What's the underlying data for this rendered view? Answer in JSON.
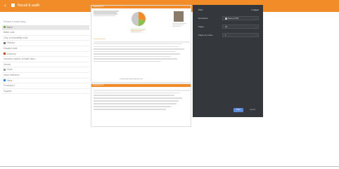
{
  "topbar": {
    "back_glyph": "‹",
    "title": "Recall & audit"
  },
  "left_list": [
    {
      "label": "Perform a recall using...",
      "type": "hdr"
    },
    {
      "label": "Batch",
      "type": "sel",
      "icon_color": "#7cb342"
    },
    {
      "label": "Batch code",
      "type": "row"
    },
    {
      "label": "Crop or traceability code",
      "type": "row"
    },
    {
      "label": "Delivery",
      "type": "row",
      "icon_color": "#607d8b"
    },
    {
      "label": "Dispatch date",
      "type": "row"
    },
    {
      "label": "Inventory",
      "type": "row",
      "icon_color": "#d84315"
    },
    {
      "label": "Inventory number of batch input",
      "type": "row"
    },
    {
      "label": "Invoice",
      "type": "row"
    },
    {
      "label": "Order",
      "type": "row",
      "icon_color": "#90a4ae"
    },
    {
      "label": "Order reference",
      "type": "row"
    },
    {
      "label": "Sales",
      "type": "row",
      "icon_color": "#1e88e5"
    },
    {
      "label": "Purchase #",
      "type": "row"
    },
    {
      "label": "Supplier",
      "type": "row"
    }
  ],
  "paper1": {
    "header": "Recall batch #",
    "section": "Inventory movements",
    "footer": "Document generated with agriculture tool"
  },
  "paper2": {
    "header": "Recall batch #"
  },
  "dialog": {
    "title": "Print",
    "pages_count": "2 pages",
    "destination_label": "Destination",
    "destination_value": "Save as PDF",
    "pages_label": "Pages",
    "pages_value": "All",
    "per_sheet_label": "Pages per sheet",
    "per_sheet_value": "1",
    "print_button": "Save",
    "cancel_button": "Cancel"
  },
  "colors": {
    "accent": "#f28c28",
    "dialog_bg": "#34373b",
    "print_button": "#5b8bd8"
  },
  "icons": {
    "back": "chevron-left-icon",
    "logo": "app-logo-icon",
    "select_chevron": "chevron-down-icon",
    "printer": "pdf-icon"
  }
}
